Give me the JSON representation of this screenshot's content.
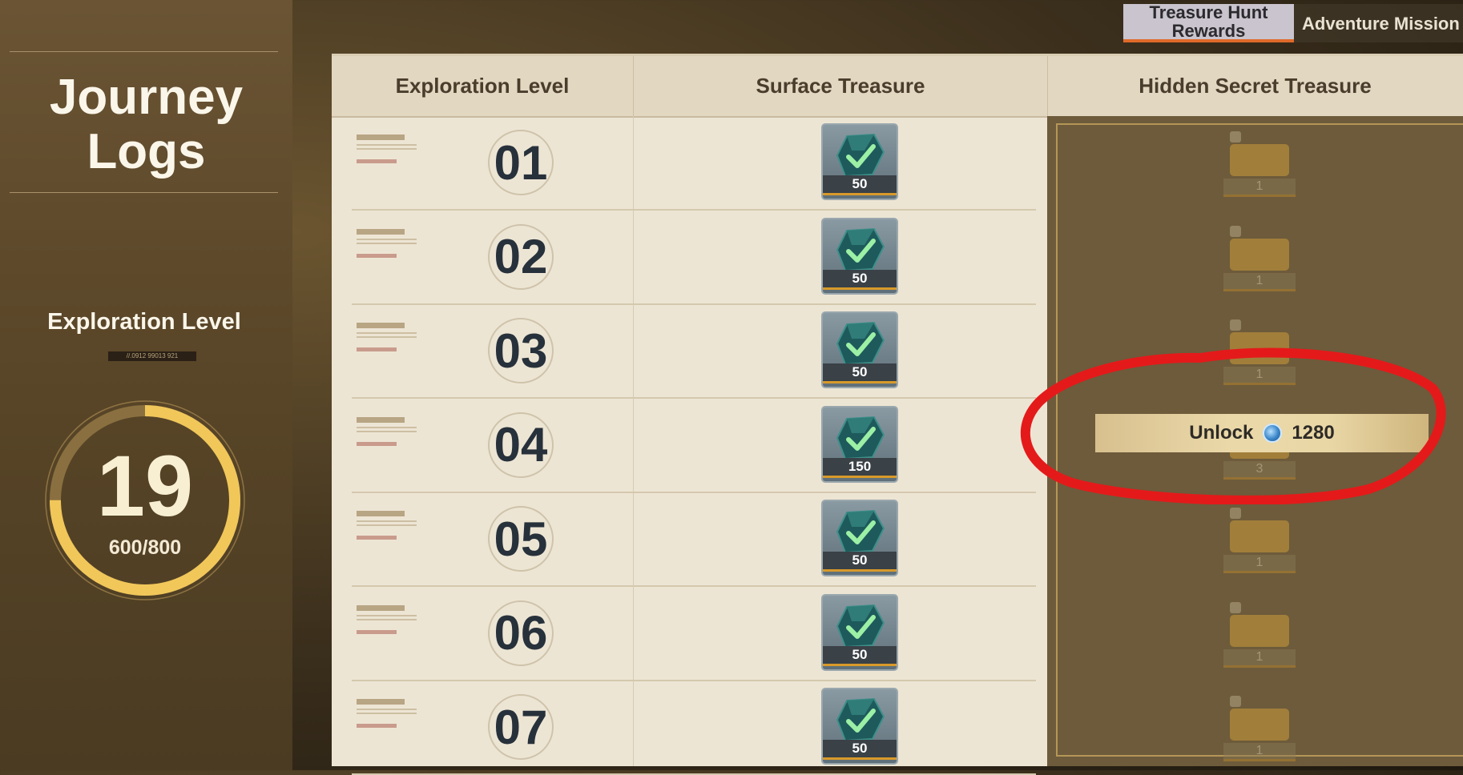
{
  "tabs": [
    {
      "label": "Treasure Hunt\nRewards",
      "active": true
    },
    {
      "label": "Adventure Mission",
      "active": false
    }
  ],
  "left_panel": {
    "title": "Journey\nLogs",
    "exploration_label": "Exploration Level",
    "level": "19",
    "xp": "600/800",
    "progress_fraction": 0.75,
    "code_text": "//.0912 99013 921"
  },
  "table": {
    "headers": [
      "Exploration Level",
      "Surface Treasure",
      "Hidden Secret Treasure"
    ],
    "rows": [
      {
        "level": "01",
        "surface_qty": "50",
        "hidden_qty": "1"
      },
      {
        "level": "02",
        "surface_qty": "50",
        "hidden_qty": "1"
      },
      {
        "level": "03",
        "surface_qty": "50",
        "hidden_qty": "1"
      },
      {
        "level": "04",
        "surface_qty": "150",
        "hidden_qty": "3"
      },
      {
        "level": "05",
        "surface_qty": "50",
        "hidden_qty": "1"
      },
      {
        "level": "06",
        "surface_qty": "50",
        "hidden_qty": "1"
      },
      {
        "level": "07",
        "surface_qty": "50",
        "hidden_qty": "1"
      }
    ]
  },
  "unlock_button": {
    "label": "Unlock",
    "cost": "1280",
    "currency_icon": "blue-coin-icon"
  },
  "colors": {
    "accent_orange": "#e06a2a",
    "gauge_gold": "#f1c75a",
    "highlight_red": "#e41a1a"
  }
}
